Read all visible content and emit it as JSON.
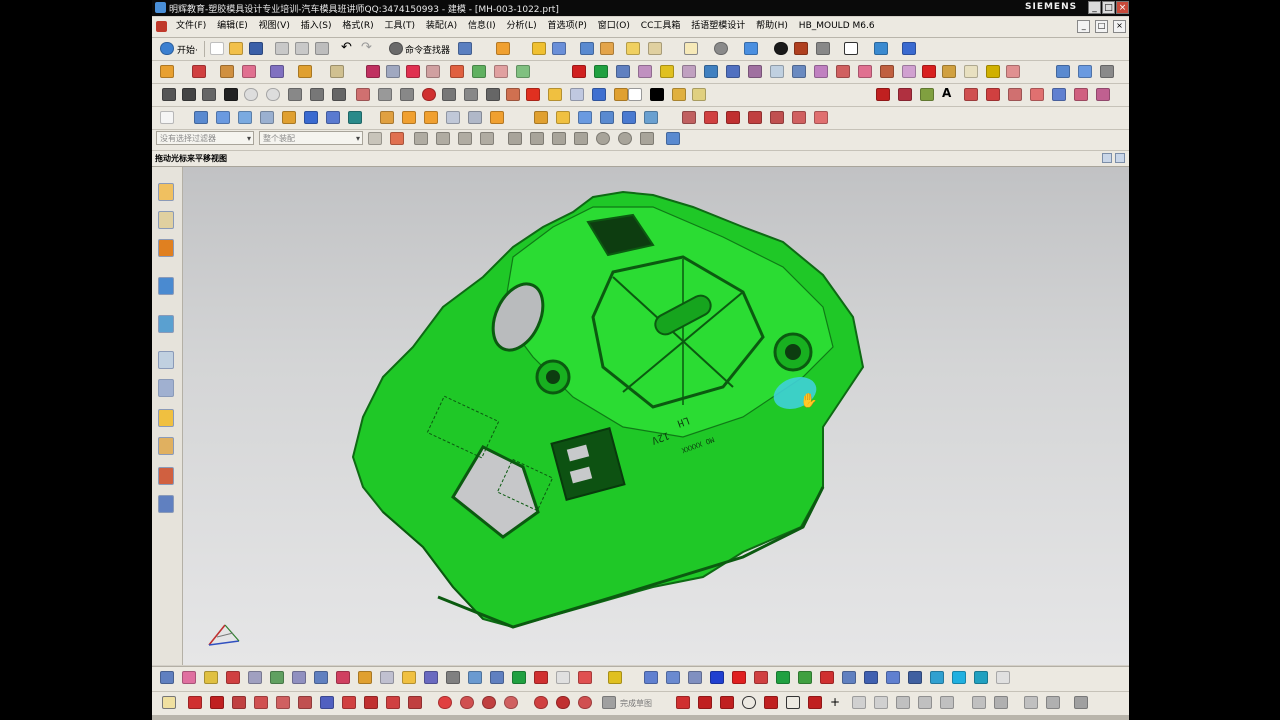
{
  "window": {
    "title": "明辉教育-塑胶模具设计专业培训-汽车模具班讲师QQ:3474150993 - 建模 - [MH-003-1022.prt]",
    "brand": "SIEMENS",
    "controls": [
      "_",
      "□",
      "×"
    ]
  },
  "menu": {
    "items": [
      "文件(F)",
      "编辑(E)",
      "视图(V)",
      "插入(S)",
      "格式(R)",
      "工具(T)",
      "装配(A)",
      "信息(I)",
      "分析(L)",
      "首选项(P)",
      "窗口(O)",
      "CC工具箱",
      "括语塑模设计",
      "帮助(H)",
      "HB_MOULD M6.6"
    ],
    "window_controls": [
      "_",
      "□",
      "×"
    ]
  },
  "toolbar1": {
    "start_label": "开始·",
    "command_finder_label": "命令查找器"
  },
  "selection_bar": {
    "filter_placeholder": "没有选择过滤器",
    "assembly_placeholder": "整个装配"
  },
  "section": {
    "label": "拖动光标来平移视图"
  },
  "bottom_toolbar": {
    "sketch_label": "完成草图"
  },
  "model": {
    "color": "#1fd22c",
    "text_12v": "12V",
    "text_lh": "LH",
    "text_mo": "MO XXXXX"
  },
  "colors": {
    "viewport_top": "#c1c2c4",
    "viewport_bottom": "#e6e6e7",
    "part_green": "#20d02a",
    "highlight_cyan": "#3fd0d8"
  }
}
